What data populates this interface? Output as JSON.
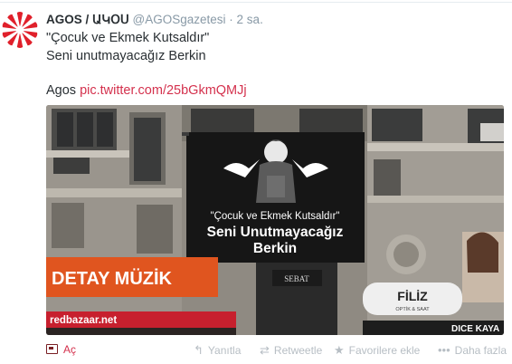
{
  "tweet": {
    "display_name": "AGOS / ԱԿՕՍ",
    "handle": "@AGOSgazetesi",
    "separator": "·",
    "time": "2 sa.",
    "text_line1": "\"Çocuk ve Ekmek Kutsaldır\"",
    "text_line2": "Seni unutmayacağız Berkin",
    "text_prefix": "Agos",
    "link": "pic.twitter.com/25bGkmQMJj",
    "colors": {
      "link": "#d4314d",
      "muted": "#8899a6",
      "text": "#292f33"
    }
  },
  "photo": {
    "banner_line1": "\"Çocuk ve Ekmek Kutsaldır\"",
    "banner_line2": "Seni Unutmayacağız",
    "banner_line3": "Berkin",
    "shop_sign_left": "DETAY MÜZİK",
    "shop_sign_left_bottom": "redbazaar.net",
    "shop_sign_center": "SEBAT",
    "shop_sign_right": "FİLİZ",
    "shop_sign_right_sub": "OPTİK & SAAT",
    "shop_sign_far_right": "DICE KAYA"
  },
  "actions": {
    "media_toggle": "Aç",
    "reply": "Yanıtla",
    "retweet": "Retweetle",
    "favorite": "Favorilere ekle",
    "more": "Daha fazla",
    "icons": {
      "reply": "reply-icon",
      "retweet": "retweet-icon",
      "favorite": "star-icon",
      "more": "more-icon",
      "media": "photo-icon"
    }
  }
}
